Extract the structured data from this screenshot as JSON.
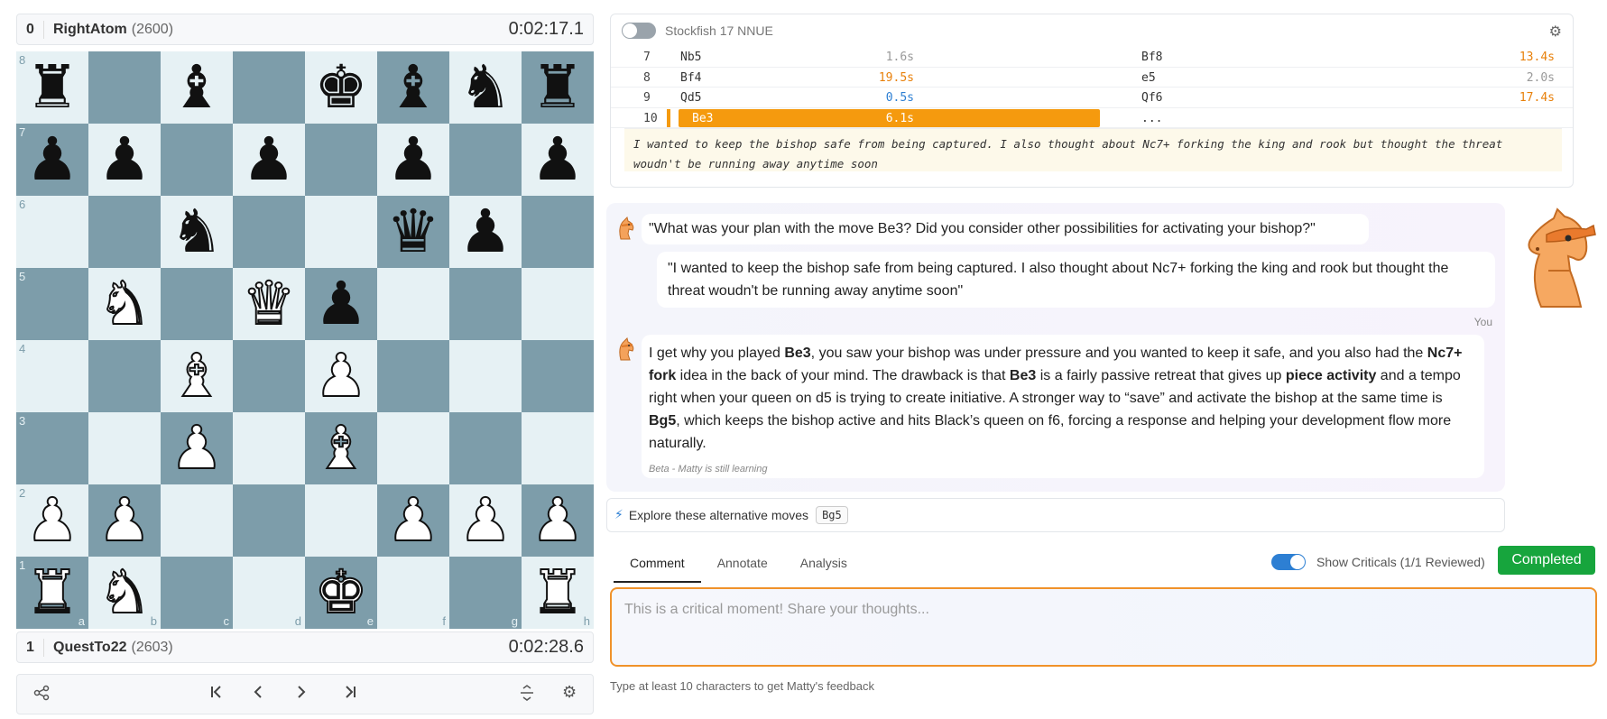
{
  "top_player": {
    "num": "0",
    "name": "RightAtom",
    "rating": "(2600)",
    "clock": "0:02:17.1"
  },
  "bottom_player": {
    "num": "1",
    "name": "QuestTo22",
    "rating": "(2603)",
    "clock": "0:02:28.6"
  },
  "board": {
    "ranks": [
      [
        "bR",
        "",
        "bB",
        "",
        "bK",
        "bB",
        "bN",
        "bR"
      ],
      [
        "bP",
        "bP",
        "",
        "bP",
        "",
        "bP",
        "",
        "bP"
      ],
      [
        "",
        "",
        "bN",
        "",
        "",
        "bQ",
        "bP",
        ""
      ],
      [
        "",
        "wN",
        "",
        "wQ",
        "bP",
        "",
        "",
        ""
      ],
      [
        "",
        "",
        "wB",
        "",
        "wP",
        "",
        "",
        ""
      ],
      [
        "",
        "",
        "wP",
        "",
        "wB",
        "",
        "",
        ""
      ],
      [
        "wP",
        "wP",
        "",
        "",
        "",
        "wP",
        "wP",
        "wP"
      ],
      [
        "wR",
        "wN",
        "",
        "",
        "wK",
        "",
        "",
        "wR"
      ]
    ],
    "rank_labels": [
      "8",
      "7",
      "6",
      "5",
      "4",
      "3",
      "2",
      "1"
    ],
    "file_labels": [
      "a",
      "b",
      "c",
      "d",
      "e",
      "f",
      "g",
      "h"
    ]
  },
  "nav": {
    "share_icon": "share-icon",
    "first_icon": "first-move-icon",
    "prev_icon": "prev-move-icon",
    "next_icon": "next-move-icon",
    "last_icon": "last-move-icon",
    "flip_icon": "flip-icon",
    "settings_icon": "gear-icon"
  },
  "engine": {
    "name": "Stockfish 17 NNUE",
    "moves": [
      {
        "num": "7",
        "white": "Nb5",
        "white_time": "1.6s",
        "white_color": "grey",
        "black": "Bf8",
        "black_time": "13.4s",
        "black_color": "orange"
      },
      {
        "num": "8",
        "white": "Bf4",
        "white_time": "19.5s",
        "white_color": "orange",
        "black": "e5",
        "black_time": "2.0s",
        "black_color": "grey"
      },
      {
        "num": "9",
        "white": "Qd5",
        "white_time": "0.5s",
        "white_color": "blue",
        "black": "Qf6",
        "black_time": "17.4s",
        "black_color": "orange"
      },
      {
        "num": "10",
        "white": "Be3",
        "white_time": "6.1s",
        "white_color": "active",
        "black": "...",
        "black_time": "",
        "black_color": "grey"
      }
    ],
    "comment": "I wanted to keep the bishop safe from being captured. I also thought about Nc7+ forking the king and rook but thought the threat woudn't be running away anytime soon"
  },
  "chat": {
    "question": "\"What was your plan with the move Be3? Did you consider other possibilities for activating your bishop?\"",
    "user_reply": "\"I wanted to keep the bishop safe from being captured. I also thought about Nc7+ forking the king and rook but thought the threat woudn't be running away anytime soon\"",
    "you_label": "You",
    "answer_parts": {
      "p1": "I get why you played ",
      "b1": "Be3",
      "p2": ", you saw your bishop was under pressure and you wanted to keep it safe, and you also had the ",
      "b2": "Nc7+ fork",
      "p3": " idea in the back of your mind. The drawback is that ",
      "b3": "Be3",
      "p4": " is a fairly passive retreat that gives up ",
      "b4": "piece activity",
      "p5": " and a tempo right when your queen on d5 is trying to create initiative. A stronger way to “save” and activate the bishop at the same time is ",
      "b5": "Bg5",
      "p6": ", which keeps the bishop active and hits Black’s queen on f6, forcing a response and helping your development flow more naturally."
    },
    "beta_note": "Beta - Matty is still learning"
  },
  "explore": {
    "label": "Explore these alternative moves",
    "moves": [
      "Bg5"
    ]
  },
  "tabs": [
    "Comment",
    "Annotate",
    "Analysis"
  ],
  "criticals_label": "Show Criticals (1/1 Reviewed)",
  "completed_label": "Completed",
  "textarea_placeholder": "This is a critical moment! Share your thoughts...",
  "hint": "Type at least 10 characters to get Matty's feedback",
  "colors": {
    "light_square": "#e6f1f4",
    "dark_square": "#7d9daa",
    "accent_orange": "#f59a0e",
    "completed_green": "#17a53d",
    "toggle_blue": "#2d7fd3"
  }
}
